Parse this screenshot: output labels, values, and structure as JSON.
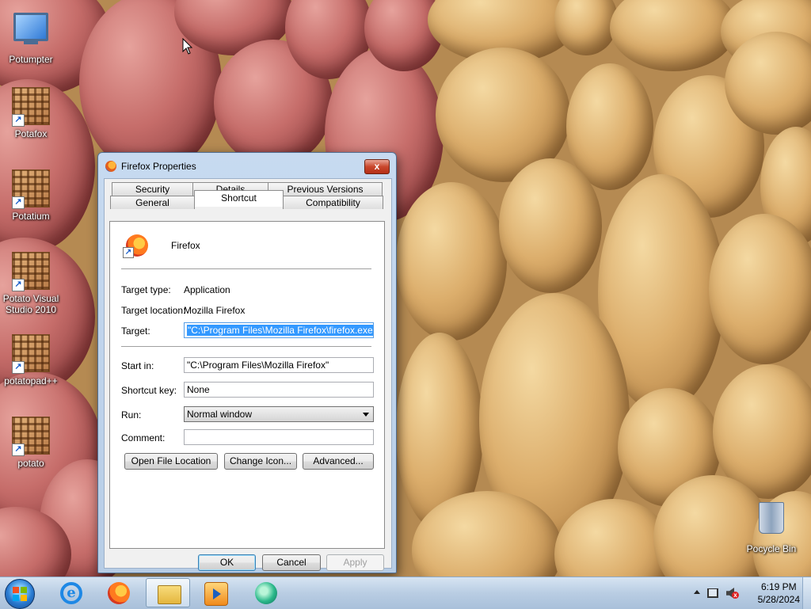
{
  "desktop": {
    "icons": [
      {
        "label": "Potumpter",
        "icon": "computer-icon"
      },
      {
        "label": "Potafox",
        "icon": "potato-shortcut-icon"
      },
      {
        "label": "Potatium",
        "icon": "potato-shortcut-icon"
      },
      {
        "label": "Potato Visual Studio 2010",
        "icon": "potato-shortcut-icon"
      },
      {
        "label": "potatopad++",
        "icon": "potato-shortcut-icon"
      },
      {
        "label": "potato",
        "icon": "potato-shortcut-icon"
      },
      {
        "label": "Pocycle Bin",
        "icon": "recycle-bin-icon"
      }
    ],
    "shortcut_arrow": "↗"
  },
  "dialog": {
    "title": "Firefox Properties",
    "close_glyph": "x",
    "tabs_row1": [
      "Security",
      "Details",
      "Previous Versions"
    ],
    "tabs_row2": [
      "General",
      "Shortcut",
      "Compatibility"
    ],
    "active_tab": "Shortcut",
    "app_name": "Firefox",
    "target_type_label": "Target type:",
    "target_type_value": "Application",
    "target_location_label": "Target location:",
    "target_location_value": "Mozilla Firefox",
    "target_label": "Target:",
    "target_value": "\"C:\\Program Files\\Mozilla Firefox\\firefox.exe\"",
    "start_in_label": "Start in:",
    "start_in_value": "\"C:\\Program Files\\Mozilla Firefox\"",
    "shortcut_key_label": "Shortcut key:",
    "shortcut_key_value": "None",
    "run_label": "Run:",
    "run_value": "Normal window",
    "comment_label": "Comment:",
    "comment_value": "",
    "open_file_location": "Open File Location",
    "change_icon": "Change Icon...",
    "advanced": "Advanced...",
    "ok": "OK",
    "cancel": "Cancel",
    "apply": "Apply"
  },
  "taskbar": {
    "apps": [
      "internet-explorer-icon",
      "firefox-icon",
      "file-explorer-icon",
      "media-player-icon",
      "browser-globe-icon"
    ],
    "active_app": "file-explorer-icon",
    "time": "6:19 PM",
    "date": "5/28/2024"
  }
}
